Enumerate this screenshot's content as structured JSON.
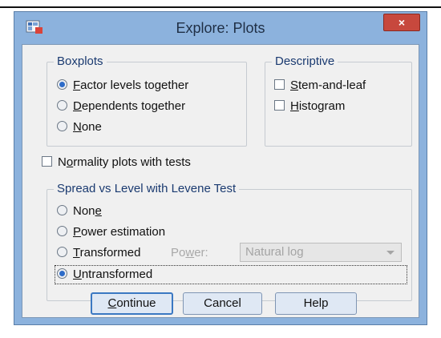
{
  "window": {
    "title": "Explore: Plots",
    "close_label": "×"
  },
  "boxplots": {
    "legend": "Boxplots",
    "options": [
      {
        "mn": "F",
        "rest": "actor levels together",
        "checked": true
      },
      {
        "mn": "D",
        "rest": "ependents together",
        "checked": false
      },
      {
        "mn": "N",
        "rest": "one",
        "checked": false
      }
    ]
  },
  "descriptive": {
    "legend": "Descriptive",
    "options": [
      {
        "mn": "S",
        "rest": "tem-and-leaf",
        "checked": false
      },
      {
        "mn": "H",
        "rest": "istogram",
        "checked": false
      }
    ]
  },
  "normality": {
    "pre": "N",
    "mn": "o",
    "rest": "rmality plots with tests",
    "checked": false
  },
  "spread": {
    "legend": "Spread vs Level with Levene Test",
    "none": {
      "pre": "Non",
      "mn": "e",
      "checked": false
    },
    "power_estimation": {
      "mn": "P",
      "rest": "ower estimation",
      "checked": false
    },
    "transformed": {
      "mn": "T",
      "rest": "ransformed",
      "checked": false
    },
    "power_label": {
      "pre": "Po",
      "mn": "w",
      "rest": "er:"
    },
    "power_select_value": "Natural log",
    "untransformed": {
      "mn": "U",
      "rest": "ntransformed",
      "checked": true
    }
  },
  "buttons": {
    "continue": {
      "mn": "C",
      "rest": "ontinue"
    },
    "cancel": "Cancel",
    "help": "Help"
  }
}
